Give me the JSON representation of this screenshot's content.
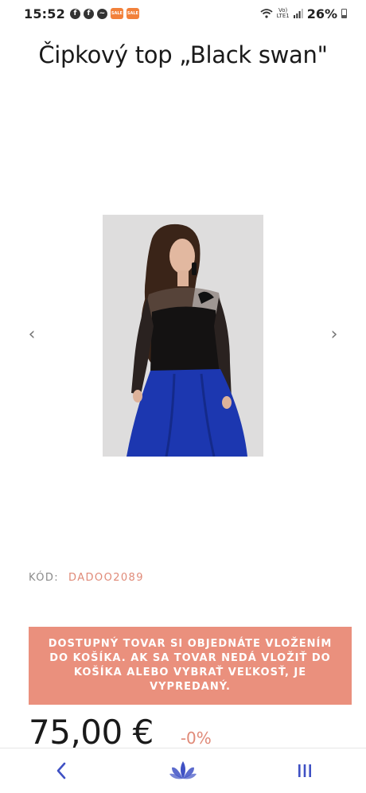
{
  "status_bar": {
    "time": "15:52",
    "network_top": "Vo)",
    "network_bottom": "LTE1",
    "battery": "26%",
    "app_badge": "SALE"
  },
  "product": {
    "title": "Čipkový top „Black swan\"",
    "code_label": "KÓD:",
    "code_value": "DADOO2089",
    "notice": "DOSTUPNÝ TOVAR SI OBJEDNÁTE VLOŽENÍM DO KOŠÍKA. AK SA TOVAR NEDÁ VLOŽIŤ DO KOŠÍKA ALEBO VYBRAŤ VEĽKOSŤ, JE VYPREDANÝ.",
    "price": "75,00 €",
    "discount": "-0%"
  },
  "carousel": {
    "prev_icon": "chevron-left-icon",
    "next_icon": "chevron-right-icon",
    "prev_glyph": "‹",
    "next_glyph": "›"
  },
  "nav": {
    "back_icon": "chevron-left-icon",
    "home_icon": "lotus-logo-icon",
    "menu_icon": "menu-lines-icon"
  },
  "colors": {
    "accent": "#ea907d",
    "accent_text": "#e08a78",
    "nav_blue": "#3f51c4"
  }
}
